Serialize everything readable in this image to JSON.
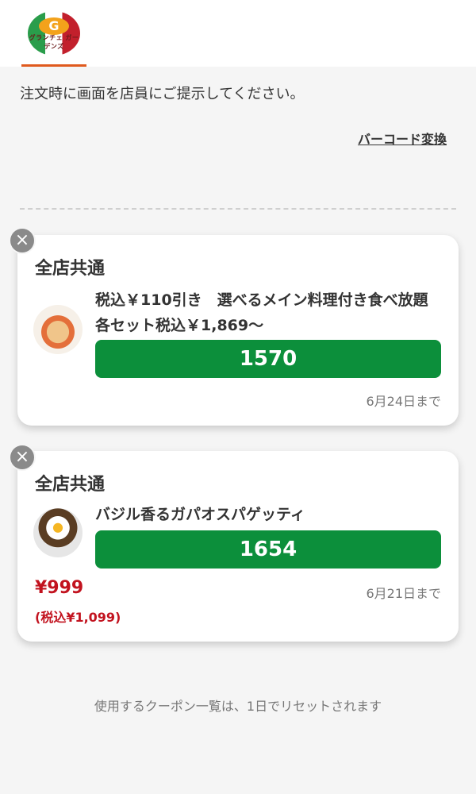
{
  "header": {
    "logo_badge": "G",
    "logo_brand": "グランチェ ガーデンズ"
  },
  "instruction": "注文時に画面を店員にご提示してください。",
  "barcode_link": "バーコード変換",
  "coupons": [
    {
      "scope": "全店共通",
      "title": "税込￥110引き　選べるメイン料理付き食べ放題各セット税込￥1,869〜",
      "code": "1570",
      "expiry": "6月24日まで"
    },
    {
      "scope": "全店共通",
      "title": "バジル香るガパオスパゲッティ",
      "code": "1654",
      "expiry": "6月21日まで",
      "price": "¥999",
      "price_tax": "(税込¥1,099)"
    }
  ],
  "close_icon": "×",
  "footer_note": "使用するクーポン一覧は、1日でリセットされます"
}
